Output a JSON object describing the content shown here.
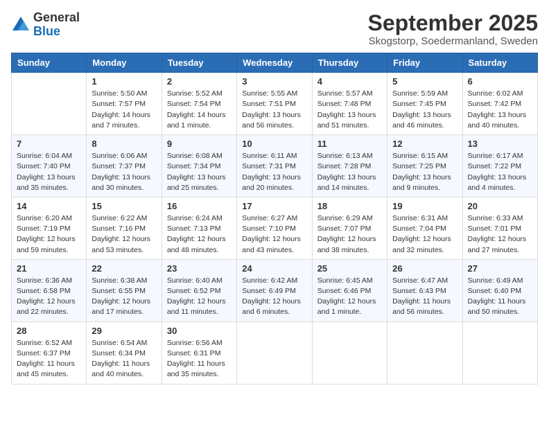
{
  "logo": {
    "general": "General",
    "blue": "Blue"
  },
  "header": {
    "month": "September 2025",
    "location": "Skogstorp, Soedermanland, Sweden"
  },
  "weekdays": [
    "Sunday",
    "Monday",
    "Tuesday",
    "Wednesday",
    "Thursday",
    "Friday",
    "Saturday"
  ],
  "weeks": [
    [
      {
        "day": "",
        "info": ""
      },
      {
        "day": "1",
        "info": "Sunrise: 5:50 AM\nSunset: 7:57 PM\nDaylight: 14 hours\nand 7 minutes."
      },
      {
        "day": "2",
        "info": "Sunrise: 5:52 AM\nSunset: 7:54 PM\nDaylight: 14 hours\nand 1 minute."
      },
      {
        "day": "3",
        "info": "Sunrise: 5:55 AM\nSunset: 7:51 PM\nDaylight: 13 hours\nand 56 minutes."
      },
      {
        "day": "4",
        "info": "Sunrise: 5:57 AM\nSunset: 7:48 PM\nDaylight: 13 hours\nand 51 minutes."
      },
      {
        "day": "5",
        "info": "Sunrise: 5:59 AM\nSunset: 7:45 PM\nDaylight: 13 hours\nand 46 minutes."
      },
      {
        "day": "6",
        "info": "Sunrise: 6:02 AM\nSunset: 7:42 PM\nDaylight: 13 hours\nand 40 minutes."
      }
    ],
    [
      {
        "day": "7",
        "info": "Sunrise: 6:04 AM\nSunset: 7:40 PM\nDaylight: 13 hours\nand 35 minutes."
      },
      {
        "day": "8",
        "info": "Sunrise: 6:06 AM\nSunset: 7:37 PM\nDaylight: 13 hours\nand 30 minutes."
      },
      {
        "day": "9",
        "info": "Sunrise: 6:08 AM\nSunset: 7:34 PM\nDaylight: 13 hours\nand 25 minutes."
      },
      {
        "day": "10",
        "info": "Sunrise: 6:11 AM\nSunset: 7:31 PM\nDaylight: 13 hours\nand 20 minutes."
      },
      {
        "day": "11",
        "info": "Sunrise: 6:13 AM\nSunset: 7:28 PM\nDaylight: 13 hours\nand 14 minutes."
      },
      {
        "day": "12",
        "info": "Sunrise: 6:15 AM\nSunset: 7:25 PM\nDaylight: 13 hours\nand 9 minutes."
      },
      {
        "day": "13",
        "info": "Sunrise: 6:17 AM\nSunset: 7:22 PM\nDaylight: 13 hours\nand 4 minutes."
      }
    ],
    [
      {
        "day": "14",
        "info": "Sunrise: 6:20 AM\nSunset: 7:19 PM\nDaylight: 12 hours\nand 59 minutes."
      },
      {
        "day": "15",
        "info": "Sunrise: 6:22 AM\nSunset: 7:16 PM\nDaylight: 12 hours\nand 53 minutes."
      },
      {
        "day": "16",
        "info": "Sunrise: 6:24 AM\nSunset: 7:13 PM\nDaylight: 12 hours\nand 48 minutes."
      },
      {
        "day": "17",
        "info": "Sunrise: 6:27 AM\nSunset: 7:10 PM\nDaylight: 12 hours\nand 43 minutes."
      },
      {
        "day": "18",
        "info": "Sunrise: 6:29 AM\nSunset: 7:07 PM\nDaylight: 12 hours\nand 38 minutes."
      },
      {
        "day": "19",
        "info": "Sunrise: 6:31 AM\nSunset: 7:04 PM\nDaylight: 12 hours\nand 32 minutes."
      },
      {
        "day": "20",
        "info": "Sunrise: 6:33 AM\nSunset: 7:01 PM\nDaylight: 12 hours\nand 27 minutes."
      }
    ],
    [
      {
        "day": "21",
        "info": "Sunrise: 6:36 AM\nSunset: 6:58 PM\nDaylight: 12 hours\nand 22 minutes."
      },
      {
        "day": "22",
        "info": "Sunrise: 6:38 AM\nSunset: 6:55 PM\nDaylight: 12 hours\nand 17 minutes."
      },
      {
        "day": "23",
        "info": "Sunrise: 6:40 AM\nSunset: 6:52 PM\nDaylight: 12 hours\nand 11 minutes."
      },
      {
        "day": "24",
        "info": "Sunrise: 6:42 AM\nSunset: 6:49 PM\nDaylight: 12 hours\nand 6 minutes."
      },
      {
        "day": "25",
        "info": "Sunrise: 6:45 AM\nSunset: 6:46 PM\nDaylight: 12 hours\nand 1 minute."
      },
      {
        "day": "26",
        "info": "Sunrise: 6:47 AM\nSunset: 6:43 PM\nDaylight: 11 hours\nand 56 minutes."
      },
      {
        "day": "27",
        "info": "Sunrise: 6:49 AM\nSunset: 6:40 PM\nDaylight: 11 hours\nand 50 minutes."
      }
    ],
    [
      {
        "day": "28",
        "info": "Sunrise: 6:52 AM\nSunset: 6:37 PM\nDaylight: 11 hours\nand 45 minutes."
      },
      {
        "day": "29",
        "info": "Sunrise: 6:54 AM\nSunset: 6:34 PM\nDaylight: 11 hours\nand 40 minutes."
      },
      {
        "day": "30",
        "info": "Sunrise: 6:56 AM\nSunset: 6:31 PM\nDaylight: 11 hours\nand 35 minutes."
      },
      {
        "day": "",
        "info": ""
      },
      {
        "day": "",
        "info": ""
      },
      {
        "day": "",
        "info": ""
      },
      {
        "day": "",
        "info": ""
      }
    ]
  ]
}
